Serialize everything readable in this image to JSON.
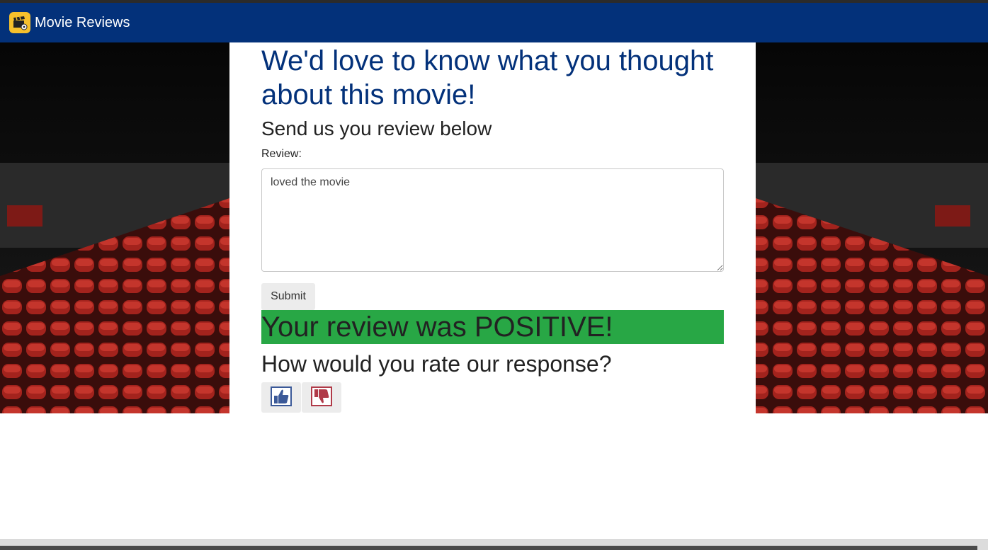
{
  "navbar": {
    "brand": "Movie Reviews",
    "logo_icon": "clapperboard-icon",
    "background": "#03317a"
  },
  "form": {
    "title": "We'd love to know what you thought about this movie!",
    "subtitle": "Send us you review below",
    "review_label": "Review:",
    "review_value": "loved the movie",
    "submit_label": "Submit"
  },
  "result": {
    "text": "Your review was POSITIVE!",
    "color": "#28a745"
  },
  "feedback": {
    "question": "How would you rate our response?",
    "thumbs_up_icon": "thumbs-up-icon",
    "thumbs_down_icon": "thumbs-down-icon"
  }
}
